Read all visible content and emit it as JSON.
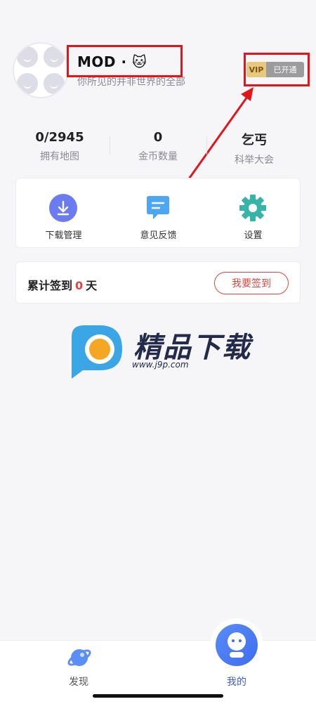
{
  "profile": {
    "username": "MOD · 🐱",
    "motto": "你所见的并非世界的全部",
    "vip_tag": "VIP",
    "vip_status": "已开通"
  },
  "stats": [
    {
      "value": "0/2945",
      "label": "拥有地图"
    },
    {
      "value": "0",
      "label": "金币数量"
    },
    {
      "value": "乞丐",
      "label": "科举大会"
    }
  ],
  "menu": {
    "download": "下载管理",
    "feedback": "意见反馈",
    "settings": "设置"
  },
  "sign": {
    "prefix": "累计签到",
    "count": "0",
    "suffix": "天",
    "button": "我要签到"
  },
  "watermark": {
    "title": "精品下载",
    "url": "www.j9p.com"
  },
  "nav": {
    "discover": "发现",
    "mine": "我的"
  },
  "colors": {
    "accent": "#3d6df0",
    "sign_red": "#e0453f",
    "annotation_red": "#e2151b"
  }
}
